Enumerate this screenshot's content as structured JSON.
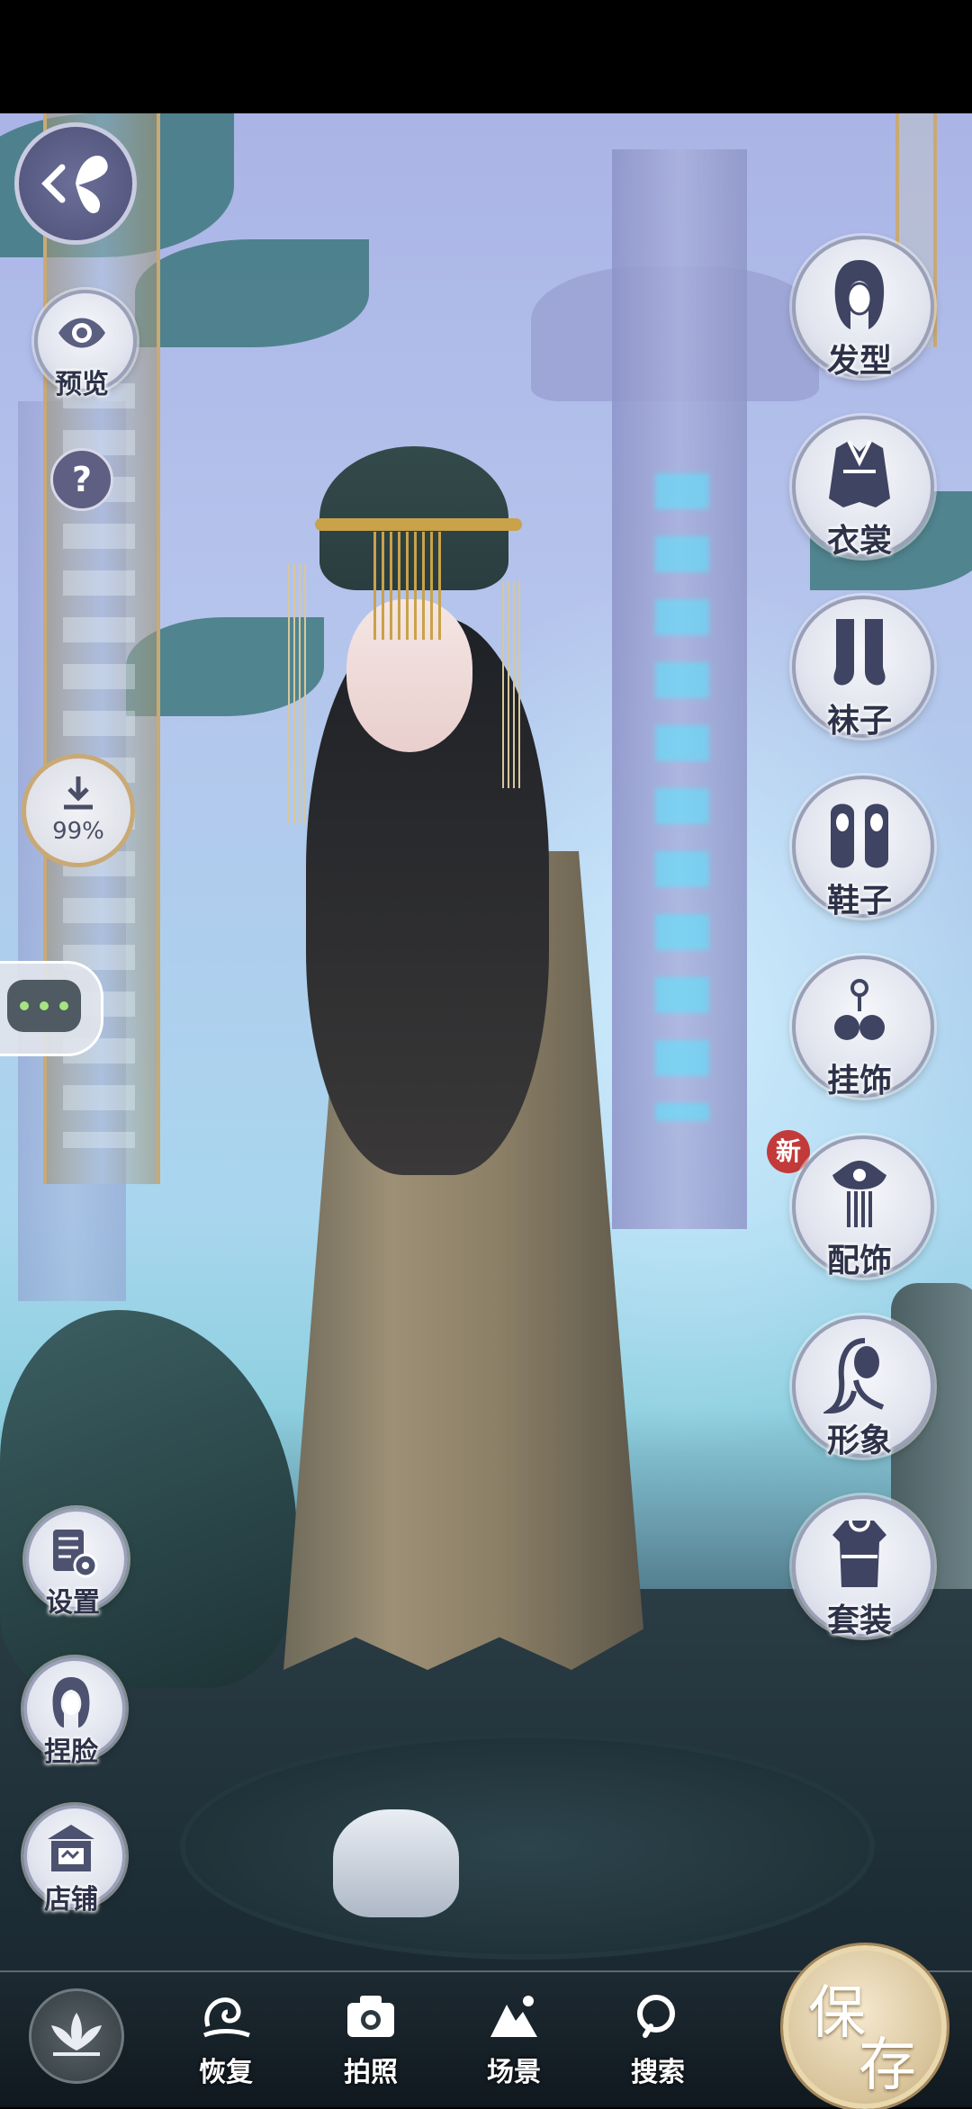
{
  "left_panel": {
    "preview_label": "预览",
    "help_symbol": "?",
    "download_percent": "99%"
  },
  "right_menu": {
    "items": [
      {
        "label": "发型",
        "icon": "hairstyle-icon"
      },
      {
        "label": "衣裳",
        "icon": "clothing-icon"
      },
      {
        "label": "袜子",
        "icon": "socks-icon"
      },
      {
        "label": "鞋子",
        "icon": "shoes-icon"
      },
      {
        "label": "挂饰",
        "icon": "pendant-icon"
      },
      {
        "label": "配饰",
        "icon": "accessory-icon"
      },
      {
        "label": "形象",
        "icon": "appearance-icon"
      },
      {
        "label": "套装",
        "icon": "outfit-icon"
      }
    ],
    "new_badge": "新"
  },
  "left_bottom": {
    "settings_label": "设置",
    "face_label": "捏脸",
    "shop_label": "店铺"
  },
  "bottom_bar": {
    "restore_label": "恢复",
    "photo_label": "拍照",
    "scene_label": "场景",
    "search_label": "搜索",
    "save_char1": "保",
    "save_char2": "存"
  },
  "colors": {
    "accent_gold": "#c9a974",
    "badge_red": "#c23a3a",
    "label_dark": "#2d3249"
  }
}
